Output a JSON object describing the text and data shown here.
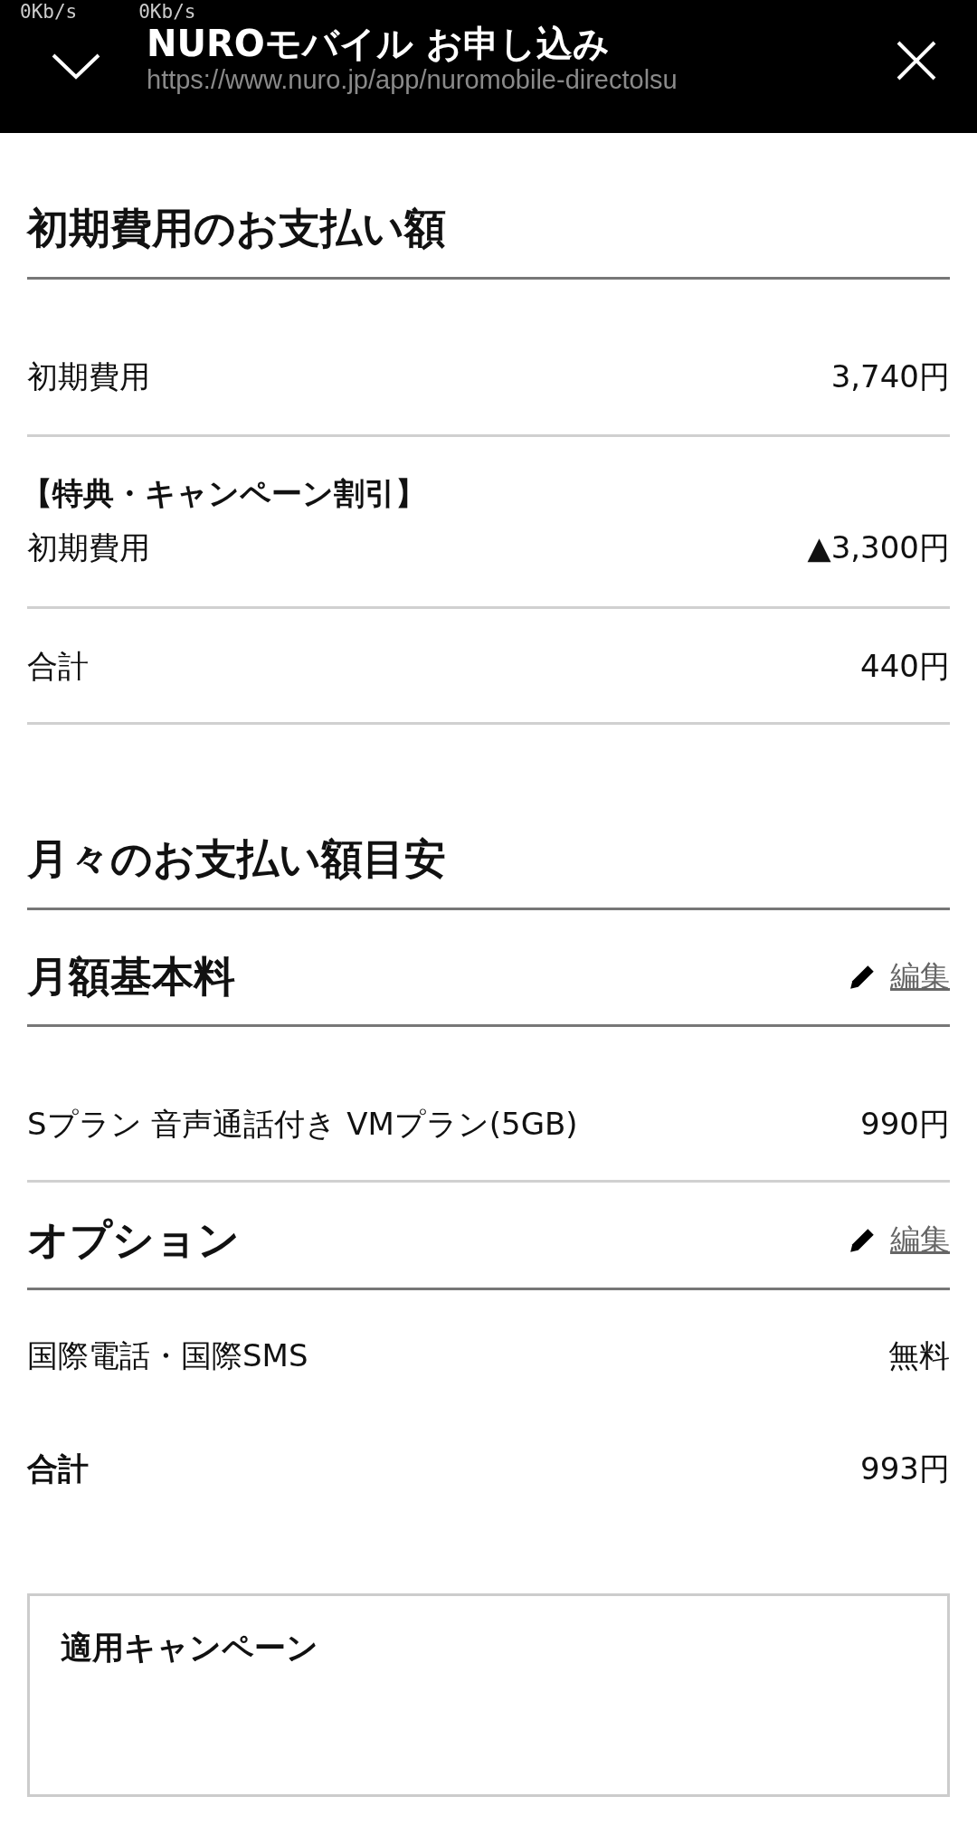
{
  "status_bar": {
    "speeds": [
      "0Kb/s",
      "0Kb/s"
    ]
  },
  "header": {
    "title": "NUROモバイル お申し込み",
    "url": "https://www.nuro.jp/app/nuromobile-directolsu"
  },
  "initial_fees": {
    "title": "初期費用のお支払い額",
    "rows": [
      {
        "kind": "item",
        "label": "初期費用",
        "value": "3,740円"
      },
      {
        "kind": "discount",
        "note": "【特典・キャンペーン割引】",
        "label": "初期費用",
        "value": "▲3,300円"
      },
      {
        "kind": "item",
        "label": "合計",
        "value": "440円"
      }
    ]
  },
  "monthly_fees": {
    "title": "月々のお支払い額目安",
    "groups": [
      {
        "title": "月額基本料",
        "edit_link": "編集",
        "rows": [
          {
            "kind": "item",
            "label": "Sプラン 音声通話付き VMプラン(5GB)",
            "value": "990円"
          }
        ]
      },
      {
        "title": "オプション",
        "edit_link": "編集",
        "rows": [
          {
            "kind": "item",
            "label": "国際電話・国際SMS",
            "value": "無料"
          },
          {
            "kind": "total",
            "label": "合計",
            "value": "993円"
          }
        ]
      }
    ]
  },
  "campaign_box": {
    "title": "適用キャンペーン"
  }
}
